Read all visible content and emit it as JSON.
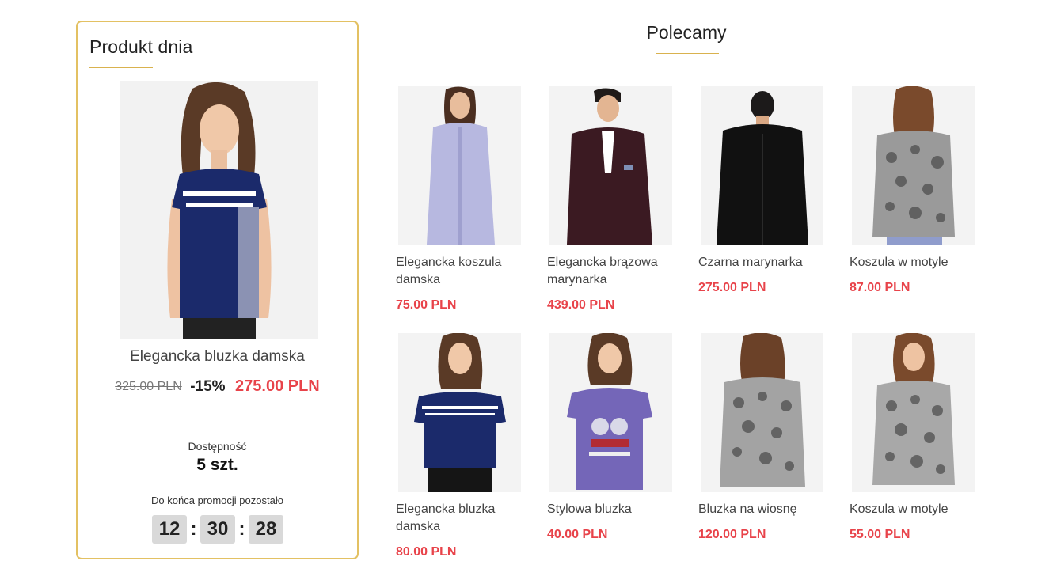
{
  "deal": {
    "title": "Produkt dnia",
    "product_name": "Elegancka bluzka damska",
    "old_price": "325.00 PLN",
    "discount": "-15%",
    "new_price": "275.00 PLN",
    "availability_label": "Dostępność",
    "availability_value": "5 szt.",
    "countdown_label": "Do końca promocji pozostało",
    "countdown": {
      "hours": "12",
      "minutes": "30",
      "seconds": "28",
      "separator": ":"
    }
  },
  "recommended": {
    "title": "Polecamy",
    "products": [
      {
        "name": "Elegancka koszula damska",
        "price": "75.00 PLN"
      },
      {
        "name": "Elegancka brązowa marynarka",
        "price": "439.00 PLN"
      },
      {
        "name": "Czarna marynarka",
        "price": "275.00 PLN"
      },
      {
        "name": "Koszula w motyle",
        "price": "87.00 PLN"
      },
      {
        "name": "Elegancka bluzka damska",
        "price": "80.00 PLN"
      },
      {
        "name": "Stylowa bluzka",
        "price": "40.00 PLN"
      },
      {
        "name": "Bluzka na wiosnę",
        "price": "120.00 PLN"
      },
      {
        "name": "Koszula w motyle",
        "price": "55.00 PLN"
      }
    ]
  },
  "colors": {
    "accent_gold": "#e3c163",
    "price_red": "#e8434a",
    "timer_bg": "#d9d9d9"
  }
}
